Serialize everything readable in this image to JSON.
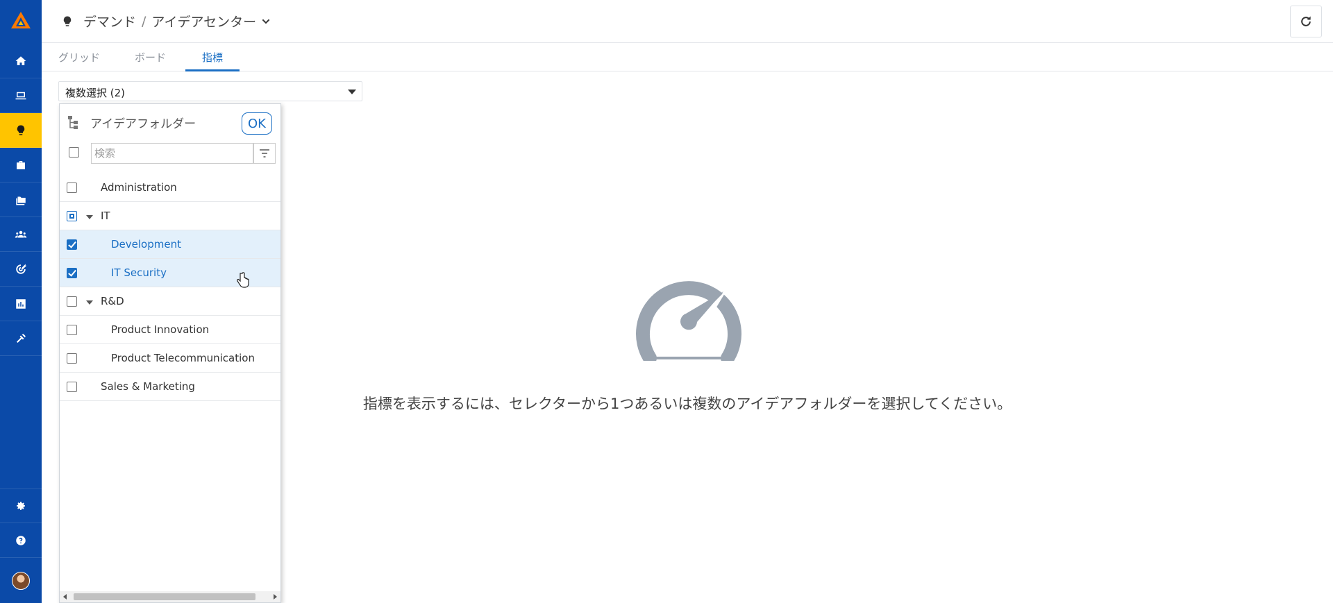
{
  "header": {
    "breadcrumb_root": "デマンド",
    "breadcrumb_sep": "/",
    "breadcrumb_current": "アイデアセンター"
  },
  "tabs": [
    {
      "label": "グリッド",
      "active": false
    },
    {
      "label": "ボード",
      "active": false
    },
    {
      "label": "指標",
      "active": true
    }
  ],
  "selector": {
    "value": "複数選択 (2)"
  },
  "panel": {
    "title": "アイデアフォルダー",
    "ok_label": "OK",
    "search_placeholder": "検索",
    "items": [
      {
        "label": "Administration",
        "state": "unchecked",
        "level": 0,
        "expander": false
      },
      {
        "label": "IT",
        "state": "partial",
        "level": 0,
        "expander": true
      },
      {
        "label": "Development",
        "state": "checked",
        "level": 1,
        "expander": false
      },
      {
        "label": "IT Security",
        "state": "checked",
        "level": 1,
        "expander": false
      },
      {
        "label": "R&D",
        "state": "unchecked",
        "level": 0,
        "expander": true
      },
      {
        "label": "Product Innovation",
        "state": "unchecked",
        "level": 1,
        "expander": false
      },
      {
        "label": "Product Telecommunication",
        "state": "unchecked",
        "level": 1,
        "expander": false
      },
      {
        "label": "Sales & Marketing",
        "state": "unchecked",
        "level": 0,
        "expander": false
      }
    ]
  },
  "empty_state": {
    "message": "指標を表示するには、セレクターから1つあるいは複数のアイデアフォルダーを選択してください。",
    "icon": "speedometer-icon"
  },
  "nav": {
    "items": [
      "home-icon",
      "laptop-icon",
      "lightbulb-icon",
      "briefcase-icon",
      "folders-icon",
      "users-icon",
      "target-icon",
      "bar-chart-icon",
      "tools-icon"
    ],
    "active": "lightbulb-icon",
    "bottom": [
      "gear-icon",
      "help-icon"
    ]
  },
  "colors": {
    "nav_bg": "#0b4aa8",
    "nav_active": "#ffc400",
    "accent": "#1b6fc4",
    "gauge": "#9aa4b0"
  }
}
